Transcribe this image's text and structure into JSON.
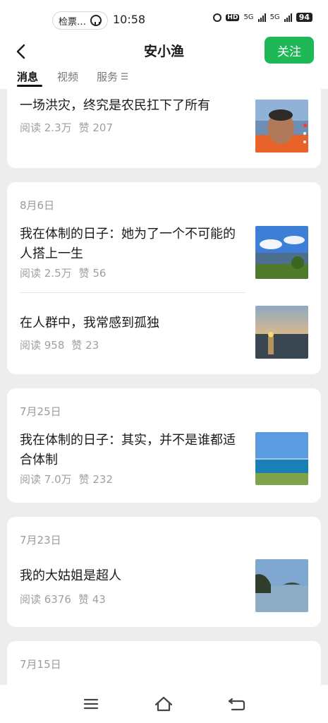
{
  "status_bar": {
    "pill_text": "检票…",
    "time": "10:58",
    "hd": "HD",
    "net1": "5G",
    "net2": "5G",
    "battery": "94"
  },
  "header": {
    "title": "安小渔",
    "follow_label": "关注"
  },
  "tabs": [
    "消息",
    "视频",
    "服务"
  ],
  "articles": [
    {
      "title": "一场洪灾，终究是农民扛下了所有",
      "reads": "阅读 2.3万",
      "likes": "赞 207"
    },
    {
      "date": "8月6日",
      "title": "我在体制的日子：她为了一个不可能的人搭上一生",
      "reads": "阅读 2.5万",
      "likes": "赞 56"
    },
    {
      "title": "在人群中，我常感到孤独",
      "reads": "阅读 958",
      "likes": "赞 23"
    },
    {
      "date": "7月25日",
      "title": "我在体制的日子：其实，并不是谁都适合体制",
      "reads": "阅读 7.0万",
      "likes": "赞 232"
    },
    {
      "date": "7月23日",
      "title": "我的大姑姐是超人",
      "reads": "阅读 6376",
      "likes": "赞 43"
    },
    {
      "date": "7月15日"
    }
  ],
  "icons": {
    "back": "back-arrow-icon",
    "menu": "menu-icon",
    "home": "home-icon",
    "return": "return-icon"
  },
  "colors": {
    "accent": "#1fb856",
    "background": "#ededed"
  }
}
